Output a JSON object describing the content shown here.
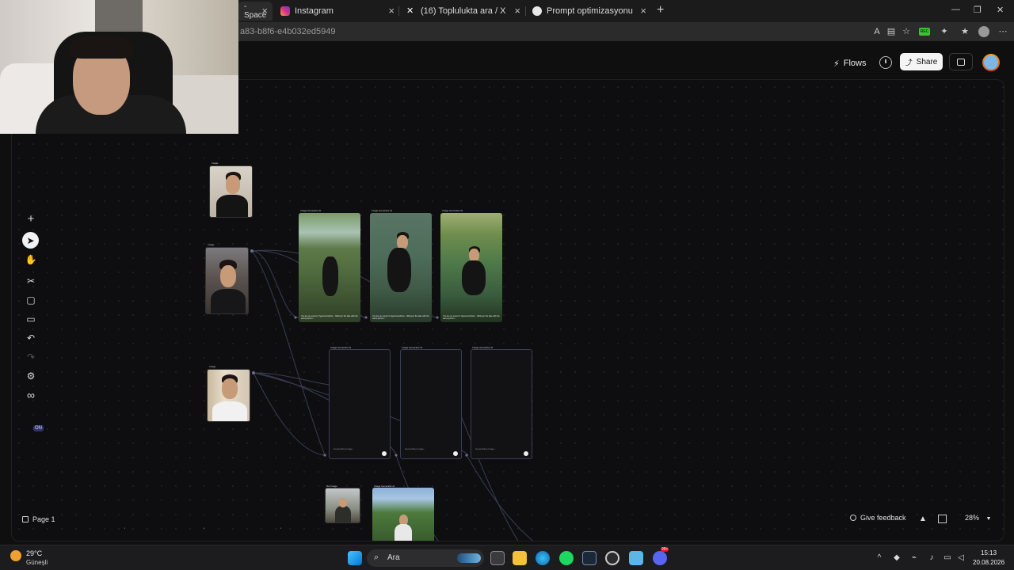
{
  "browser": {
    "tabs": [
      {
        "title": "- Space",
        "active": true
      },
      {
        "title": "Instagram"
      },
      {
        "title": "(16) Toplulukta ara / X"
      },
      {
        "title": "Prompt optimizasyonu"
      }
    ],
    "url": "a83-b8f6-e4b032ed5949",
    "extension_badge": "REC"
  },
  "header": {
    "flows_label": "Flows",
    "share_label": "Share"
  },
  "toolbar": {
    "tools": [
      "plus-icon",
      "pointer-icon",
      "hand-icon",
      "scissors-icon",
      "frame-icon",
      "comment-icon",
      "undo-icon",
      "redo-icon",
      "settings-icon",
      "infinity-icon"
    ],
    "on_badge": "ON"
  },
  "canvas": {
    "image_nodes": [
      {
        "label": "Image"
      },
      {
        "label": "Image"
      },
      {
        "label": "Image"
      }
    ],
    "generated_nodes": [
      {
        "label": "Image Generator AI",
        "caption": "You are an expert in hyperreal photo... fishing in the lake with the same person..."
      },
      {
        "label": "Image Generator AI",
        "caption": "You are an expert in hyperreal photo... fishing in the lake with the same person..."
      },
      {
        "label": "Image Generator AI",
        "caption": "You are an expert in hyperreal photo... fishing in the lake with the same person..."
      }
    ],
    "pending_nodes": [
      {
        "label": "Image Generator AI",
        "status": "Generating image..."
      },
      {
        "label": "Image Generator AI",
        "status": "Generating image..."
      },
      {
        "label": "Image Generator AI",
        "status": "Generating image..."
      }
    ],
    "bottom_nodes": [
      {
        "label": "Ref Image"
      },
      {
        "label": "Image Generator AI"
      }
    ]
  },
  "footer": {
    "page_label": "Page 1",
    "feedback_label": "Give feedback",
    "zoom": "28%"
  },
  "taskbar": {
    "temperature": "29°C",
    "weather": "Güneşli",
    "search_placeholder": "Ara",
    "time": "15:13",
    "date": "20.08.2026",
    "discord_badge": "99+"
  }
}
